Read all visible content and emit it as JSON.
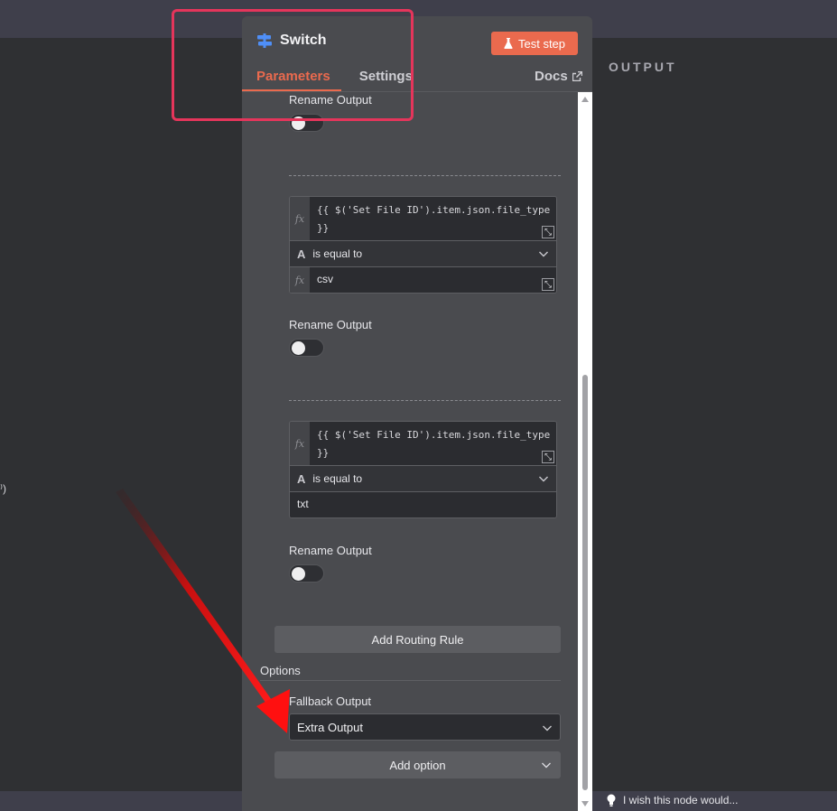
{
  "output_panel": {
    "title": "OUTPUT"
  },
  "left_panel": {
    "edge_text": "⁾)"
  },
  "feedback": {
    "text": "I wish this node would..."
  },
  "node": {
    "name": "Switch",
    "test_step_label": "Test step",
    "tabs": [
      {
        "label": "Parameters",
        "active": true
      },
      {
        "label": "Settings",
        "active": false
      }
    ],
    "docs_label": "Docs"
  },
  "rules": [
    {
      "rename_output_label": "Rename Output",
      "rename_output_enabled": false
    },
    {
      "value1": "{{ $('Set File ID').item.json.file_type\n}}",
      "operator": "is equal to",
      "value2": "csv",
      "rename_output_label": "Rename Output",
      "rename_output_enabled": false
    },
    {
      "value1": "{{ $('Set File ID').item.json.file_type\n}}",
      "operator": "is equal to",
      "value2": "txt",
      "rename_output_label": "Rename Output",
      "rename_output_enabled": false
    }
  ],
  "add_routing_rule_label": "Add Routing Rule",
  "options": {
    "title": "Options",
    "fallback_output_label": "Fallback Output",
    "fallback_output_value": "Extra Output",
    "add_option_label": "Add option"
  },
  "colors": {
    "accent": "#ea6a4e",
    "highlight_box": "#e5355b",
    "annotation_arrow": "#e01010"
  },
  "icons": [
    "switch-icon",
    "flask-icon",
    "external-link-icon",
    "fx-icon",
    "expand-icon",
    "string-type-icon",
    "chevron-down-icon",
    "lightbulb-icon"
  ]
}
